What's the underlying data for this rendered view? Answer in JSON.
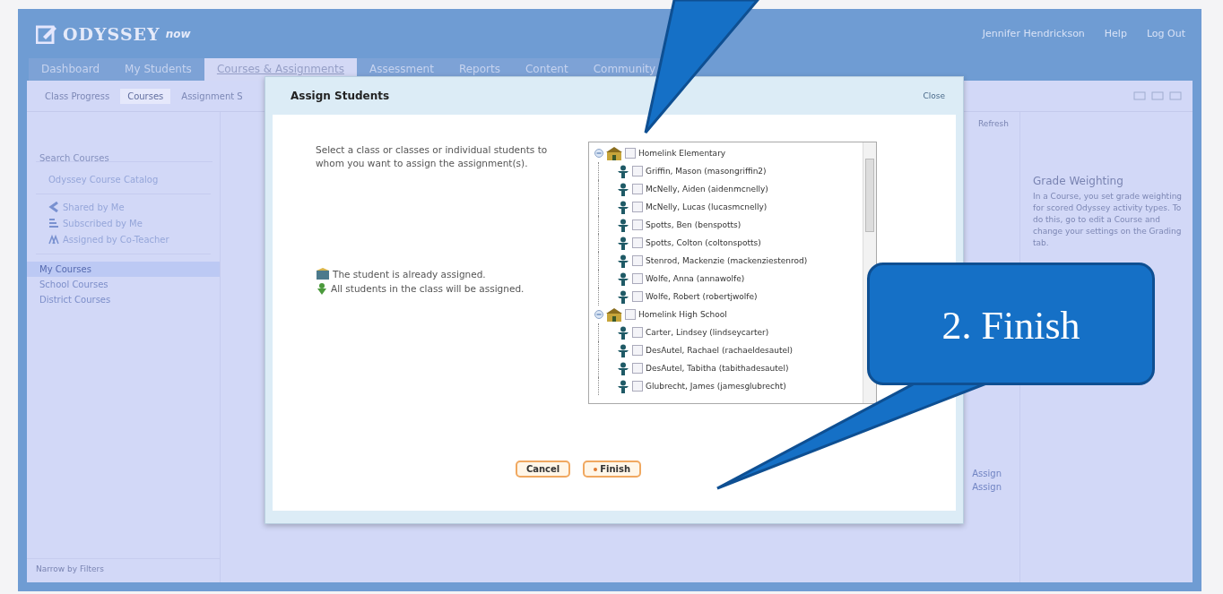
{
  "header": {
    "logo": "ODYSSEY",
    "logo_suffix": "now",
    "user_links": [
      "Jennifer Hendrickson",
      "Help",
      "Log Out"
    ]
  },
  "nav_tabs": [
    {
      "label": "Dashboard",
      "selected": false
    },
    {
      "label": "My Students",
      "selected": false
    },
    {
      "label": "Courses & Assignments",
      "selected": true
    },
    {
      "label": "Assessment",
      "selected": false
    },
    {
      "label": "Reports",
      "selected": false
    },
    {
      "label": "Content",
      "selected": false
    },
    {
      "label": "Community",
      "selected": false
    }
  ],
  "subnav_tabs": [
    {
      "label": "Class Progress",
      "selected": false
    },
    {
      "label": "Courses",
      "selected": true
    },
    {
      "label": "Assignment S",
      "selected": false
    }
  ],
  "sidebar": {
    "search_placeholder": "Search Courses",
    "catalog": "Odyssey Course Catalog",
    "shared_items": [
      {
        "kind": "shared",
        "label": "Shared by Me"
      },
      {
        "kind": "subscribed",
        "label": "Subscribed by Me"
      },
      {
        "kind": "coteacher",
        "label": "Assigned by Co-Teacher"
      }
    ],
    "course_groups": [
      {
        "label": "My Courses",
        "selected": true
      },
      {
        "label": "School Courses",
        "selected": false
      },
      {
        "label": "District Courses",
        "selected": false
      }
    ],
    "footer": "Narrow by Filters"
  },
  "middle": {
    "refresh": "Refresh",
    "assign_links": [
      "Assign",
      "Assign"
    ]
  },
  "right_panel": {
    "title": "Grade Weighting",
    "text": "In a Course, you set grade weighting for scored Odyssey activity types. To do this, go to edit a Course and change your settings on the Grading tab."
  },
  "modal": {
    "title": "Assign Students",
    "close": "Close",
    "instructions": "Select a class or classes or individual students to whom you want to assign the assignment(s).",
    "legend": [
      {
        "kind": "assigned",
        "text": "The student is already assigned."
      },
      {
        "kind": "class",
        "text": "All students in the class will be assigned."
      }
    ],
    "tree": [
      {
        "label": "Homelink Elementary",
        "checked": false,
        "expanded": true,
        "children": [
          {
            "label": "Griffin, Mason (masongriffin2)",
            "checked": false
          },
          {
            "label": "McNelly, Aiden (aidenmcnelly)",
            "checked": false
          },
          {
            "label": "McNelly, Lucas (lucasmcnelly)",
            "checked": false
          },
          {
            "label": "Spotts, Ben (benspotts)",
            "checked": false
          },
          {
            "label": "Spotts, Colton (coltonspotts)",
            "checked": false
          },
          {
            "label": "Stenrod, Mackenzie (mackenziestenrod)",
            "checked": false
          },
          {
            "label": "Wolfe, Anna (annawolfe)",
            "checked": false
          },
          {
            "label": "Wolfe, Robert (robertjwolfe)",
            "checked": false
          }
        ]
      },
      {
        "label": "Homelink High School",
        "checked": false,
        "expanded": true,
        "children": [
          {
            "label": "Carter, Lindsey (lindseycarter)",
            "checked": false
          },
          {
            "label": "DesAutel, Rachael (rachaeldesautel)",
            "checked": false
          },
          {
            "label": "DesAutel, Tabitha (tabithadesautel)",
            "checked": false
          },
          {
            "label": "Glubrecht, James (jamesglubrecht)",
            "checked": false
          }
        ]
      }
    ],
    "buttons": [
      {
        "kind": "cancel",
        "label": "Cancel"
      },
      {
        "kind": "finish",
        "label": "Finish"
      }
    ]
  },
  "callouts": [
    {
      "text": "2. Finish"
    }
  ]
}
